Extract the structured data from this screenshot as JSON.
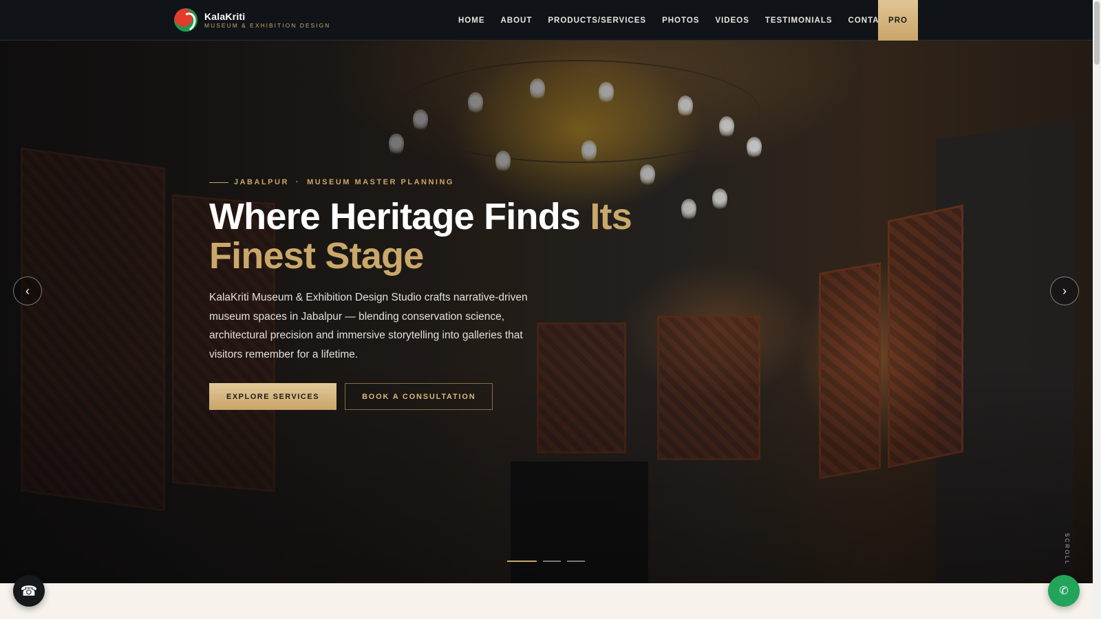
{
  "brand": {
    "name": "KalaKriti",
    "tagline": "MUSEUM & EXHIBITION DESIGN"
  },
  "nav": {
    "items": [
      "HOME",
      "ABOUT",
      "PRODUCTS/SERVICES",
      "PHOTOS",
      "VIDEOS",
      "TESTIMONIALS",
      "CONTACT"
    ],
    "pro_label": "PRO"
  },
  "hero": {
    "eyebrow_location": "JABALPUR",
    "eyebrow_separator": "·",
    "eyebrow_service": "MUSEUM MASTER PLANNING",
    "title_white": "Where Heritage Finds ",
    "title_gold": "Its Finest Stage",
    "description": "KalaKriti Museum & Exhibition Design Studio crafts narrative-driven museum spaces in Jabalpur — blending conservation science, architectural precision and immersive storytelling into galleries that visitors remember for a lifetime.",
    "primary_cta": "EXPLORE SERVICES",
    "secondary_cta": "BOOK A CONSULTATION",
    "prev_icon": "‹",
    "next_icon": "›",
    "slides_total": 3,
    "active_slide": 1,
    "scroll_label": "SCROLL"
  },
  "floating": {
    "call_icon": "☎",
    "chat_icon": "✆"
  },
  "colors": {
    "accent_gold": "#c9a86a",
    "navbar_bg": "#101418",
    "chat_green": "#22a45b"
  }
}
